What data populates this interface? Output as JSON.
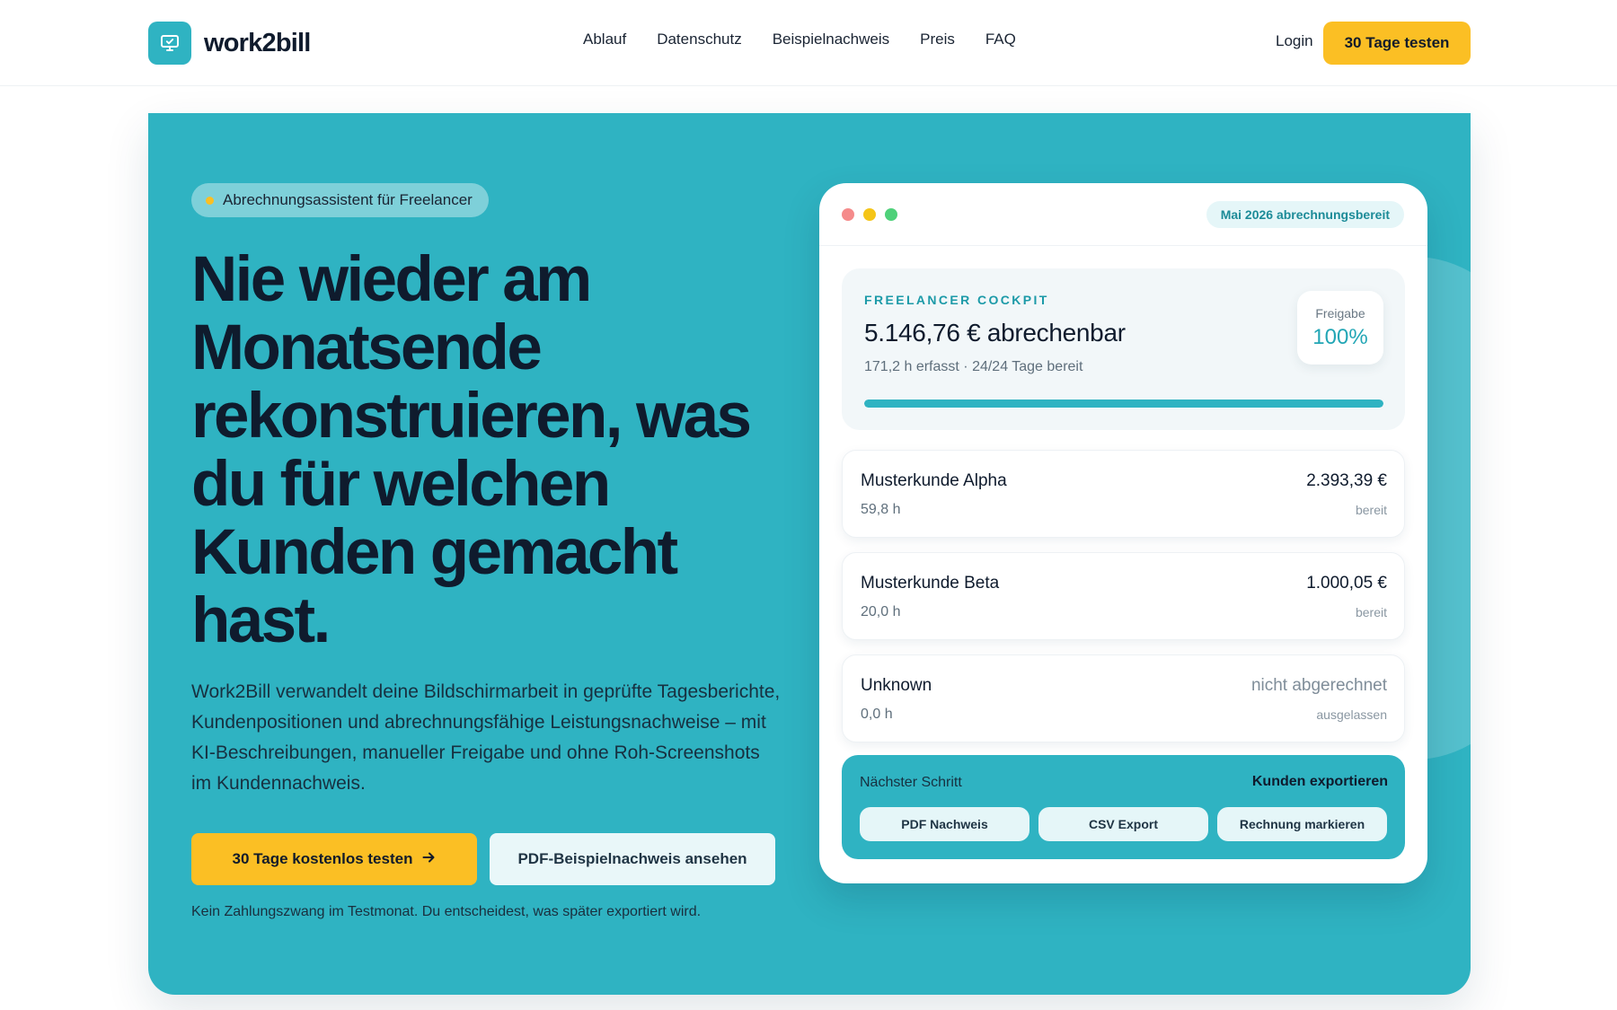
{
  "brand": {
    "name": "work2bill",
    "icon": "monitor-check-icon",
    "accent": "#2fb3c2",
    "cta_color": "#fbbf24"
  },
  "nav": {
    "items": [
      "Ablauf",
      "Datenschutz",
      "Beispielnachweis",
      "Preis",
      "FAQ"
    ],
    "login": "Login",
    "cta": "30 Tage testen"
  },
  "hero": {
    "pill": "Abrechnungsassistent für Freelancer",
    "headline_lines": [
      "Nie wieder am",
      "Monatsende",
      "rekonstruieren, was",
      "du für welchen",
      "Kunden gemacht",
      "hast."
    ],
    "lead": "Work2Bill verwandelt deine Bildschirmarbeit in geprüfte Tagesberichte, Kundenpositionen und abrechnungsfähige Leistungsnachweise – mit KI-Beschreibungen, manueller Freigabe und ohne Roh-Screenshots im Kundennachweis.",
    "primary_cta": "30 Tage kostenlos testen",
    "secondary_cta": "PDF-Beispielnachweis ansehen",
    "note": "Kein Zahlungszwang im Testmonat. Du entscheidest, was später exportiert wird."
  },
  "card": {
    "window_dots": [
      "#f58b8b",
      "#f5c518",
      "#4fd17a"
    ],
    "status_badge": "Mai 2026 abrechnungsbereit",
    "cockpit": {
      "label": "FREELANCER COCKPIT",
      "amount": "5.146,76 € abrechenbar",
      "meta": "171,2 h erfasst · 24/24 Tage bereit",
      "release_label": "Freigabe",
      "release_value": "100%",
      "progress_percent": 100
    },
    "clients": [
      {
        "name": "Musterkunde Alpha",
        "hours": "59,8 h",
        "amount": "2.393,39 €",
        "status": "bereit",
        "muted": false
      },
      {
        "name": "Musterkunde Beta",
        "hours": "20,0 h",
        "amount": "1.000,05 €",
        "status": "bereit",
        "muted": false
      },
      {
        "name": "Unknown",
        "hours": "0,0 h",
        "amount": "nicht abgerechnet",
        "status": "ausgelassen",
        "muted": true
      }
    ],
    "next_step": {
      "label": "Nächster Schritt",
      "action": "Kunden exportieren",
      "buttons": [
        "PDF Nachweis",
        "CSV Export",
        "Rechnung markieren"
      ]
    }
  }
}
